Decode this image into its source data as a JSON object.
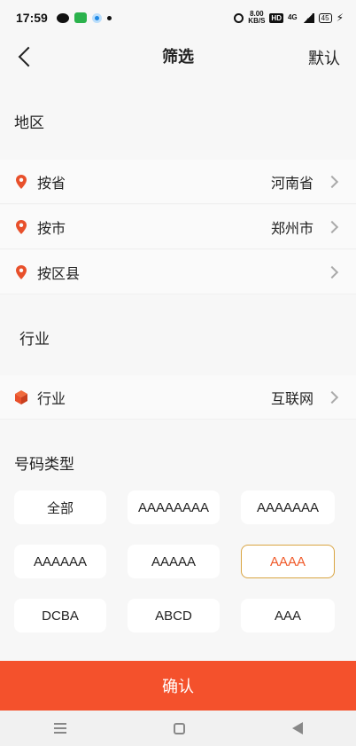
{
  "status": {
    "time": "17:59",
    "speed_top": "8.00",
    "speed_unit": "KB/S",
    "hd": "HD",
    "network": "4G",
    "battery": "45"
  },
  "nav": {
    "title": "筛选",
    "reset": "默认"
  },
  "region": {
    "title": "地区",
    "rows": [
      {
        "label": "按省",
        "value": "河南省"
      },
      {
        "label": "按市",
        "value": "郑州市"
      },
      {
        "label": "按区县",
        "value": ""
      }
    ]
  },
  "industry": {
    "title": "行业",
    "row": {
      "label": "行业",
      "value": "互联网"
    }
  },
  "number_type": {
    "title": "号码类型",
    "options": [
      "全部",
      "AAAAAAAA",
      "AAAAAAA",
      "AAAAAA",
      "AAAAA",
      "AAAA",
      "DCBA",
      "ABCD",
      "AAA"
    ],
    "selected": "AAAA"
  },
  "confirm_label": "确认",
  "colors": {
    "accent": "#f4512c",
    "pin": "#e8502b",
    "selected_border": "#d9a441"
  }
}
